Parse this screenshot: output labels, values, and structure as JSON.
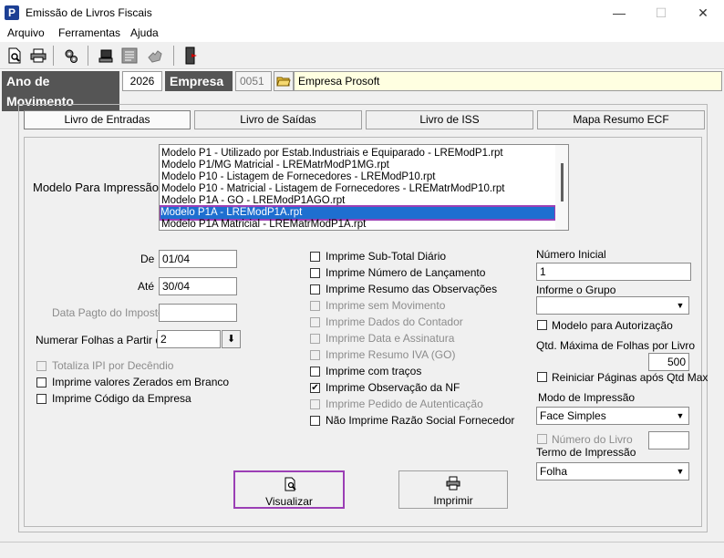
{
  "window": {
    "app_icon_letter": "P",
    "title": "Emissão de Livros Fiscais",
    "minimize": "—",
    "maximize": "☐",
    "close": "✕"
  },
  "menu": [
    "Arquivo",
    "Ferramentas",
    "Ajuda"
  ],
  "header": {
    "ano_label": "Ano de Movimento",
    "ano_value": "2026",
    "empresa_label": "Empresa",
    "empresa_code": "0051",
    "empresa_name": "Empresa Prosoft"
  },
  "tabs": [
    "Livro de Entradas",
    "Livro de Saídas",
    "Livro de ISS",
    "Mapa Resumo ECF"
  ],
  "modelo": {
    "label": "Modelo Para Impressão",
    "items": [
      "Modelo P1 - Utilizado por Estab.Industriais e Equiparado - LREModP1.rpt",
      "Modelo P1/MG Matricial - LREMatrModP1MG.rpt",
      "Modelo P10 - Listagem de Fornecedores - LREModP10.rpt",
      "Modelo P10 - Matricial - Listagem de Fornecedores - LREMatrModP10.rpt",
      "Modelo P1A - GO - LREModP1AGO.rpt",
      "Modelo P1A - LREModP1A.rpt",
      "Modelo P1A Matricial - LREMatrModP1A.rpt"
    ],
    "selected_index": 5
  },
  "left": {
    "de_label": "De",
    "de_value": "01/04",
    "ate_label": "Até",
    "ate_value": "30/04",
    "data_pagto_label": "Data Pagto do Imposto",
    "data_pagto_value": "",
    "numerar_label": "Numerar Folhas a Partir de",
    "numerar_value": "2",
    "numerar_btn": "⬇",
    "checks": [
      {
        "label": "Totaliza IPI por Decêndio",
        "checked": false,
        "disabled": true
      },
      {
        "label": "Imprime valores Zerados em Branco",
        "checked": false,
        "disabled": false
      },
      {
        "label": "Imprime Código da Empresa",
        "checked": false,
        "disabled": false
      }
    ]
  },
  "middle": {
    "checks": [
      {
        "label": "Imprime Sub-Total Diário",
        "checked": false,
        "disabled": false
      },
      {
        "label": "Imprime Número de Lançamento",
        "checked": false,
        "disabled": false
      },
      {
        "label": "Imprime Resumo das Observações",
        "checked": false,
        "disabled": false
      },
      {
        "label": "Imprime sem Movimento",
        "checked": false,
        "disabled": true
      },
      {
        "label": "Imprime Dados do Contador",
        "checked": false,
        "disabled": true
      },
      {
        "label": "Imprime Data e Assinatura",
        "checked": false,
        "disabled": true
      },
      {
        "label": "Imprime Resumo IVA (GO)",
        "checked": false,
        "disabled": true
      },
      {
        "label": "Imprime com traços",
        "checked": false,
        "disabled": false
      },
      {
        "label": "Imprime Observação da NF",
        "checked": true,
        "disabled": false
      },
      {
        "label": "Imprime Pedido de Autenticação",
        "checked": false,
        "disabled": true
      },
      {
        "label": "Não Imprime Razão Social Fornecedor",
        "checked": false,
        "disabled": false
      }
    ]
  },
  "right": {
    "numero_inicial_label": "Número Inicial",
    "numero_inicial_value": "1",
    "grupo_label": "Informe o Grupo",
    "grupo_value": "",
    "autorizacao_label": "Modelo para Autorização",
    "qtd_label": "Qtd. Máxima de Folhas por Livro",
    "qtd_value": "500",
    "reiniciar_label": "Reiniciar Páginas após Qtd Max",
    "modo_label": "Modo de Impressão",
    "modo_value": "Face Simples",
    "numero_livro_label": "Número do Livro",
    "numero_livro_value": "",
    "termo_label": "Termo de Impressão",
    "termo_value": "Folha"
  },
  "buttons": {
    "visualizar": "Visualizar",
    "imprimir": "Imprimir"
  },
  "colors": {
    "selection": "#1e6fd0",
    "highlight_border": "#9b3fb5",
    "dark_label": "#555555",
    "company_field": "#ffffe1"
  }
}
